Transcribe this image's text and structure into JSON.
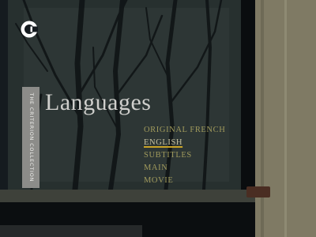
{
  "brand": {
    "spine_text": "THE CRITERION COLLECTION",
    "logo_icon": "criterion-c-logo-icon"
  },
  "page": {
    "title": "Languages"
  },
  "menu": {
    "selected_index": 1,
    "items": [
      {
        "label": "ORIGINAL FRENCH"
      },
      {
        "label": "ENGLISH"
      },
      {
        "label": "SUBTITLES"
      },
      {
        "label": "MAIN"
      },
      {
        "label": "MOVIE"
      }
    ]
  },
  "colors": {
    "menu_text": "#a09a5c",
    "selection_underline": "#c9a326",
    "spine_background": "#8c8c89",
    "title_text": "#cfcfcc"
  }
}
